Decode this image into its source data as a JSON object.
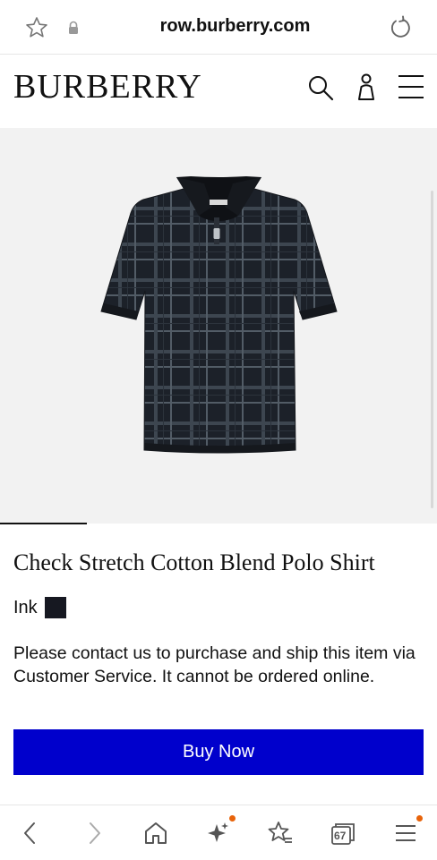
{
  "browser": {
    "url": "row.burberry.com",
    "icons": [
      "star-outline-icon",
      "lock-icon",
      "reload-icon"
    ]
  },
  "header": {
    "brand": "BURBERRY",
    "icons": [
      "search-icon",
      "account-icon",
      "menu-icon"
    ]
  },
  "product": {
    "image_alt": "Check Stretch Cotton Blend Polo Shirt",
    "title": "Check Stretch Cotton Blend Polo Shirt",
    "color_name": "Ink",
    "swatch_color": "#161821",
    "notice": "Please contact us to purchase and ship this item via Customer Service. It cannot be ordered online.",
    "buy_label": "Buy Now",
    "buy_color": "#0000cc"
  },
  "toolbar": {
    "tab_count": "67",
    "icons": [
      "back-icon",
      "forward-icon",
      "home-icon",
      "sparkle-icon",
      "bookmarks-icon",
      "tabs-icon",
      "hamburger-icon"
    ],
    "notification_dot_color": "#e8630a"
  }
}
